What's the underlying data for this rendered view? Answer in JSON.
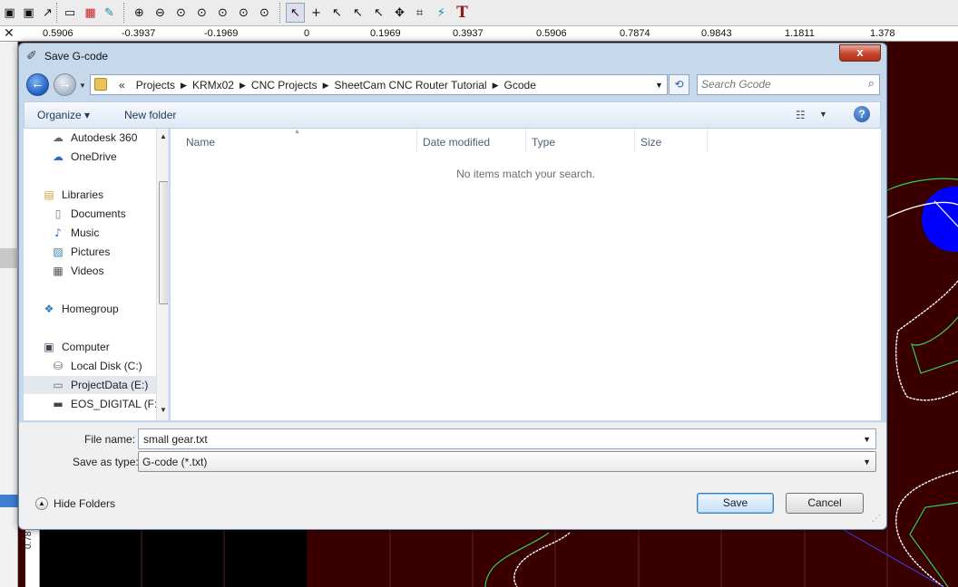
{
  "toolbar": {
    "text_tool_glyph": "T"
  },
  "ruler": {
    "close_glyph": "✕",
    "ticks": [
      "0.5906",
      "-0.3937",
      "-0.1969",
      "0",
      "0.1969",
      "0.3937",
      "0.5906",
      "0.7874",
      "0.9843",
      "1.1811",
      "1.378"
    ],
    "vertical_tick": "0.78"
  },
  "dialog": {
    "title": "Save G-code",
    "close_glyph": "x",
    "address": {
      "overflow": "«",
      "crumbs": [
        "Projects",
        "KRMx02",
        "CNC Projects",
        "SheetCam CNC Router Tutorial",
        "Gcode"
      ],
      "separator": "▶"
    },
    "search": {
      "placeholder": "Search Gcode"
    },
    "commands": {
      "organize": "Organize ▾",
      "new_folder": "New folder",
      "help": "?"
    },
    "nav": {
      "items": [
        {
          "label": "Autodesk 360",
          "icon": "cloud-icon"
        },
        {
          "label": "OneDrive",
          "icon": "cloud-icon"
        },
        {
          "label": "Libraries",
          "icon": "library-icon"
        },
        {
          "label": "Documents",
          "icon": "document-icon"
        },
        {
          "label": "Music",
          "icon": "music-icon"
        },
        {
          "label": "Pictures",
          "icon": "picture-icon"
        },
        {
          "label": "Videos",
          "icon": "video-icon"
        },
        {
          "label": "Homegroup",
          "icon": "homegroup-icon"
        },
        {
          "label": "Computer",
          "icon": "computer-icon"
        },
        {
          "label": "Local Disk (C:)",
          "icon": "disk-icon"
        },
        {
          "label": "ProjectData (E:)",
          "icon": "drive-icon"
        },
        {
          "label": "EOS_DIGITAL (F:)",
          "icon": "drive-icon"
        }
      ]
    },
    "columns": [
      "Name",
      "Date modified",
      "Type",
      "Size"
    ],
    "empty_message": "No items match your search.",
    "file_name_label": "File name:",
    "file_name_value": "small gear.txt",
    "save_type_label": "Save as type:",
    "save_type_value": "G-code (*.txt)",
    "hide_folders": "Hide Folders",
    "save": "Save",
    "cancel": "Cancel"
  },
  "colors": {
    "canvas_background": "#3a0000",
    "toolpath_white": "#ffffff",
    "toolpath_green": "#33cc55",
    "marker_blue": "#0000ff",
    "save_button_border": "#3c7fb1"
  }
}
